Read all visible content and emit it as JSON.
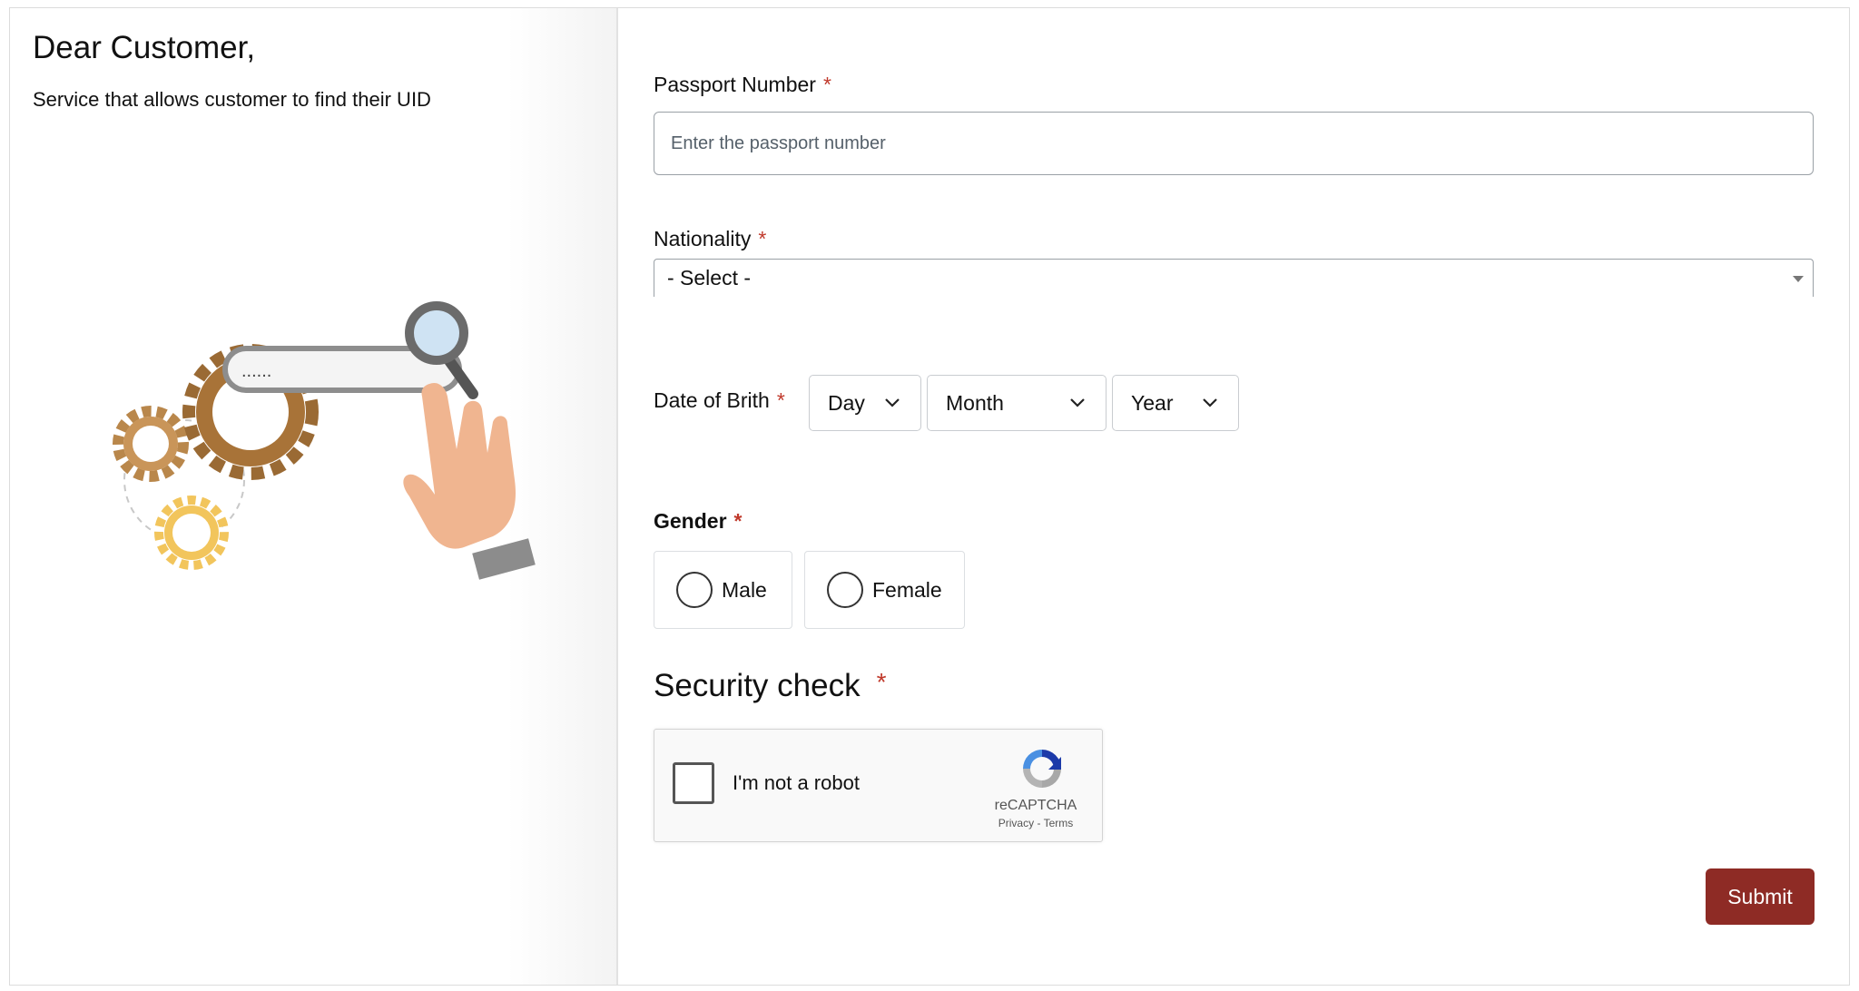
{
  "intro": {
    "greeting": "Dear Customer,",
    "description": "Service that allows customer to find their UID",
    "illustration_search_text": "......"
  },
  "form": {
    "passport": {
      "label": "Passport Number",
      "required_mark": "*",
      "placeholder": "Enter the passport number",
      "value": ""
    },
    "nationality": {
      "label": "Nationality",
      "required_mark": "*",
      "selected": "- Select -"
    },
    "dob": {
      "label": "Date of Brith",
      "required_mark": "*",
      "day": "Day",
      "month": "Month",
      "year": "Year"
    },
    "gender": {
      "label": "Gender",
      "required_mark": "*",
      "options": [
        "Male",
        "Female"
      ],
      "selected": null
    },
    "security": {
      "title": "Security check",
      "required_mark": "*",
      "captcha_label": "I'm not a robot",
      "captcha_brand": "reCAPTCHA",
      "privacy": "Privacy",
      "separator": "-",
      "terms": "Terms",
      "checked": false
    },
    "submit_label": "Submit"
  },
  "colors": {
    "required": "#c0392b",
    "submit_bg": "#8e2b25",
    "gear_brown": "#9a6a34",
    "gear_gold": "#f2c55c",
    "hand_skin": "#f0b590"
  },
  "icons": [
    "gears-search-illustration",
    "magnifier-icon",
    "chevron-down-icon",
    "caret-down-icon",
    "recaptcha-icon"
  ]
}
